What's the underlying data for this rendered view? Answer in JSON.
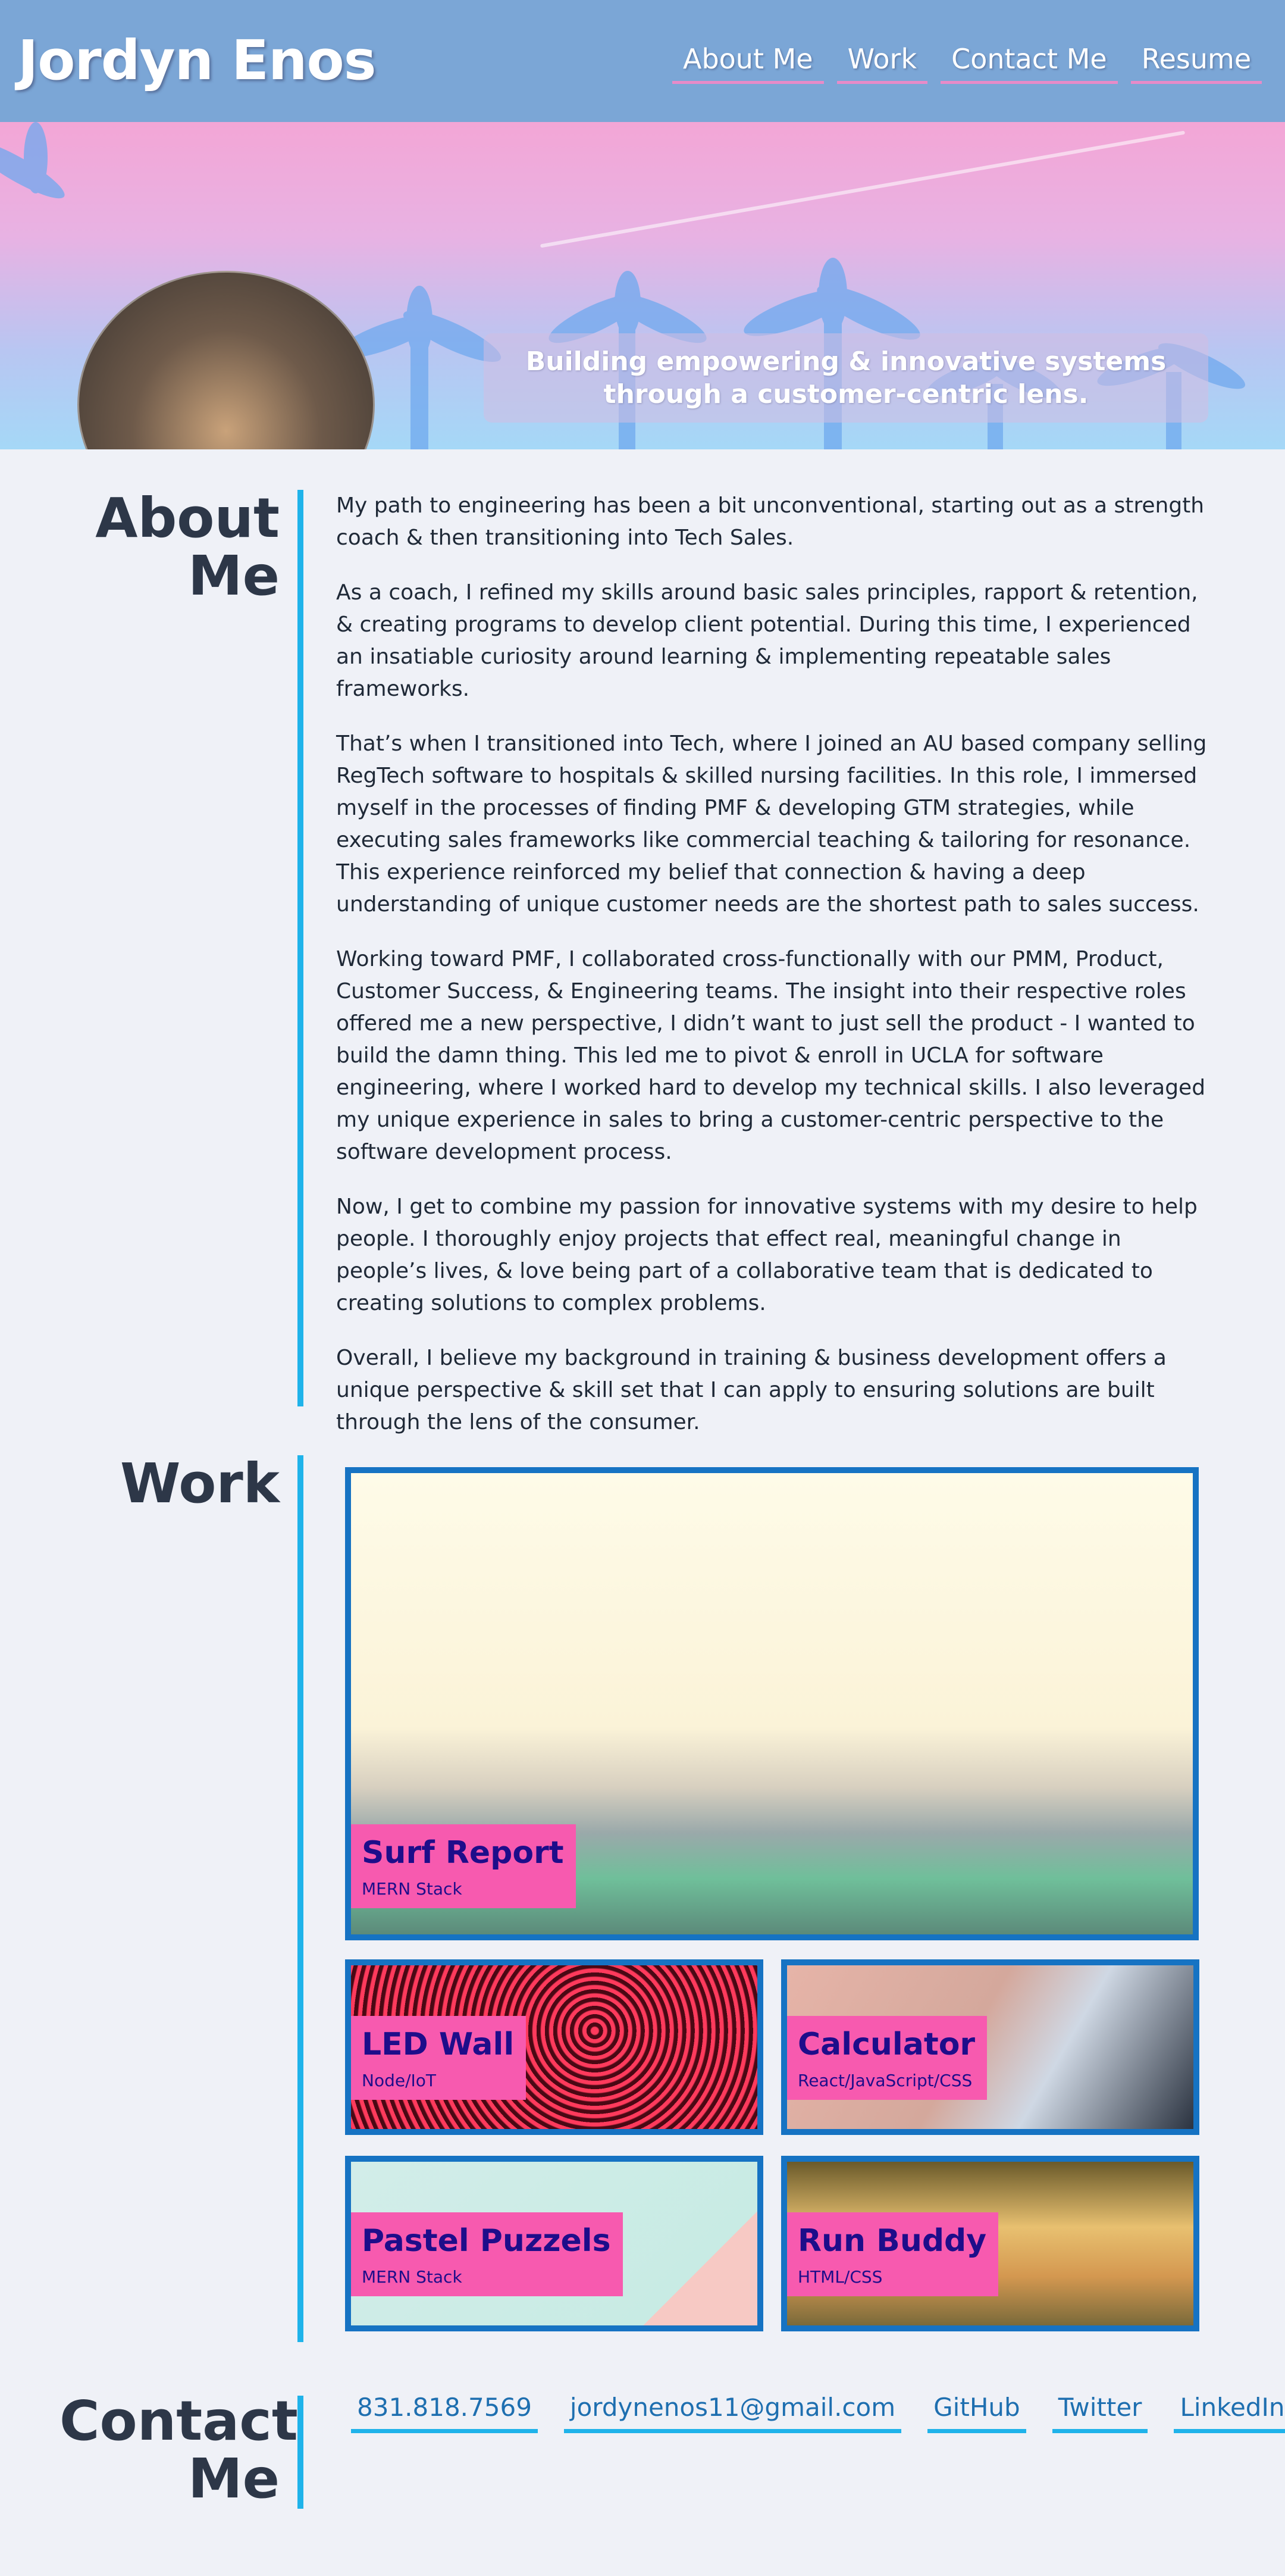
{
  "header": {
    "site_name": "Jordyn Enos",
    "nav": [
      "About Me",
      "Work",
      "Contact Me",
      "Resume"
    ]
  },
  "hero": {
    "tagline": "Building empowering & innovative systems through a customer-centric lens."
  },
  "about": {
    "title_line1": "About",
    "title_line2": "Me",
    "paragraphs": [
      "My path to engineering has been a bit unconventional, starting out as a strength coach & then transitioning into Tech Sales.",
      "As a coach, I refined my skills around basic sales principles, rapport & retention, & creating programs to develop client potential. During this time, I experienced an insatiable curiosity around learning & implementing repeatable sales frameworks.",
      "That’s when I transitioned into Tech, where I joined an AU based company selling RegTech software to hospitals & skilled nursing facilities. In this role, I immersed myself in the processes of finding PMF & developing GTM strategies, while executing sales frameworks like commercial teaching & tailoring for resonance. This experience reinforced my belief that connection & having a deep understanding of unique customer needs are the shortest path to sales success.",
      "Working toward PMF, I collaborated cross-functionally with our PMM, Product, Customer Success, & Engineering teams. The insight into their respective roles offered me a new perspective, I didn’t want to just sell the product - I wanted to build the damn thing. This led me to pivot & enroll in UCLA for software engineering, where I worked hard to develop my technical skills. I also leveraged my unique experience in sales to bring a customer-centric perspective to the software development process.",
      "Now, I get to combine my passion for innovative systems with my desire to help people. I thoroughly enjoy projects that effect real, meaningful change in people’s lives, & love being part of a collaborative team that is dedicated to creating solutions to complex problems.",
      "Overall, I believe my background in training & business development offers a unique perspective & skill set that I can apply to ensuring solutions are built through the lens of the consumer."
    ]
  },
  "work": {
    "title": "Work",
    "projects": [
      {
        "name": "Surf Report",
        "stack": "MERN Stack"
      },
      {
        "name": "LED Wall",
        "stack": "Node/IoT"
      },
      {
        "name": "Calculator",
        "stack": "React/JavaScript/CSS"
      },
      {
        "name": "Pastel Puzzels",
        "stack": "MERN Stack"
      },
      {
        "name": "Run Buddy",
        "stack": "HTML/CSS"
      }
    ]
  },
  "contact": {
    "title_line1": "Contact",
    "title_line2": "Me",
    "links": [
      "831.818.7569",
      "jordynenos11@gmail.com",
      "GitHub",
      "Twitter",
      "LinkedIn"
    ]
  },
  "colors": {
    "header_bg": "#7ba6d6",
    "accent_bar": "#1fb3ea",
    "card_border": "#1673c3",
    "label_bg": "#f75aaf",
    "label_text": "#1e0d8a",
    "nav_underline": "#e88bc8"
  }
}
